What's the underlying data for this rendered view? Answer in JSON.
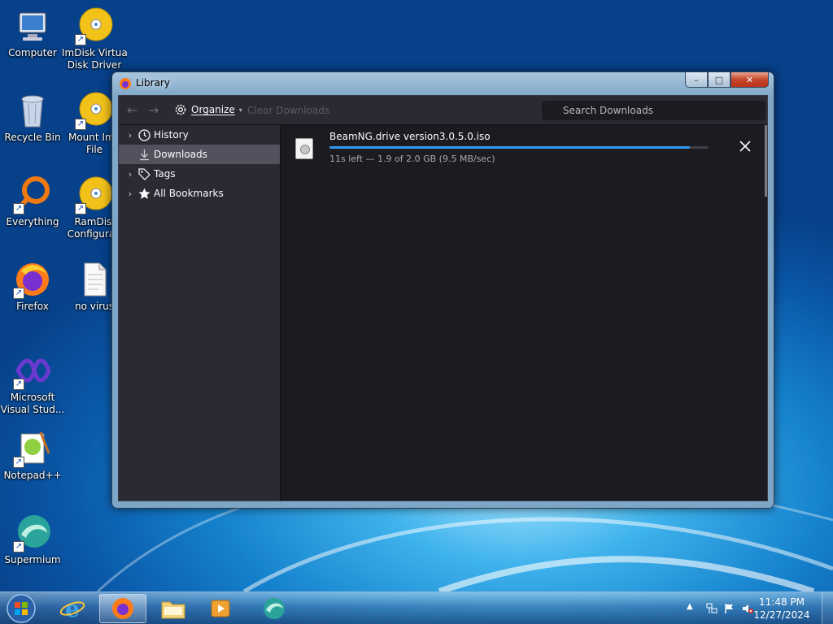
{
  "desktop": {
    "icons": [
      {
        "label": "Computer",
        "icon": "computer-icon"
      },
      {
        "label": "ImDisk Virtual Disk Driver",
        "line1": "ImDisk Virtual",
        "line2": "Disk Driver",
        "icon": "disc-icon"
      },
      {
        "label": "Recycle Bin",
        "icon": "recycle-bin-icon"
      },
      {
        "label": "Mount Image File",
        "line1": "Mount Ima",
        "line2": "File",
        "icon": "disc-icon"
      },
      {
        "label": "Everything",
        "icon": "everything-search-icon"
      },
      {
        "label": "RamDisk Configuration",
        "line1": "RamDisl",
        "line2": "Configurati",
        "icon": "disc-icon"
      },
      {
        "label": "Firefox",
        "icon": "firefox-icon"
      },
      {
        "label": "no virus",
        "icon": "text-file-icon"
      },
      {
        "label": "Microsoft Visual Studio",
        "line1": "Microsoft",
        "line2": "Visual Stud...",
        "icon": "visual-studio-icon"
      },
      {
        "label": "Notepad++",
        "icon": "notepad-plus-plus-icon"
      },
      {
        "label": "Supermium",
        "icon": "supermium-icon"
      }
    ]
  },
  "window": {
    "title": "Library",
    "controls": {
      "minimize": "–",
      "maximize": "□",
      "close": "✕"
    },
    "toolbar": {
      "organize_label": "Organize",
      "clear_label": "Clear Downloads",
      "search_placeholder": "Search Downloads"
    },
    "sidebar": {
      "items": [
        {
          "label": "History",
          "icon": "clock-icon",
          "expandable": true
        },
        {
          "label": "Downloads",
          "icon": "download-icon",
          "expandable": false,
          "selected": true
        },
        {
          "label": "Tags",
          "icon": "tag-icon",
          "expandable": true
        },
        {
          "label": "All Bookmarks",
          "icon": "star-icon",
          "expandable": true
        }
      ]
    },
    "downloads": [
      {
        "filename": "BeamNG.drive version3.0.5.0.iso",
        "status": "11s left — 1.9 of 2.0 GB (9.5 MB/sec)",
        "progress": 0.95
      }
    ]
  },
  "taskbar": {
    "buttons": [
      {
        "name": "internet-explorer",
        "icon": "internet-explorer-icon"
      },
      {
        "name": "firefox",
        "icon": "firefox-icon",
        "active": true
      },
      {
        "name": "file-explorer",
        "icon": "folder-icon"
      },
      {
        "name": "media-player",
        "icon": "media-player-icon"
      },
      {
        "name": "supermium",
        "icon": "supermium-icon"
      }
    ],
    "clock": {
      "time": "11:48 PM",
      "date": "12/27/2024"
    }
  },
  "colors": {
    "accent": "#2f9bf0",
    "window_bg": "#1c1b22",
    "sidebar_bg": "#2b2a33",
    "selected_row": "#52525e"
  }
}
